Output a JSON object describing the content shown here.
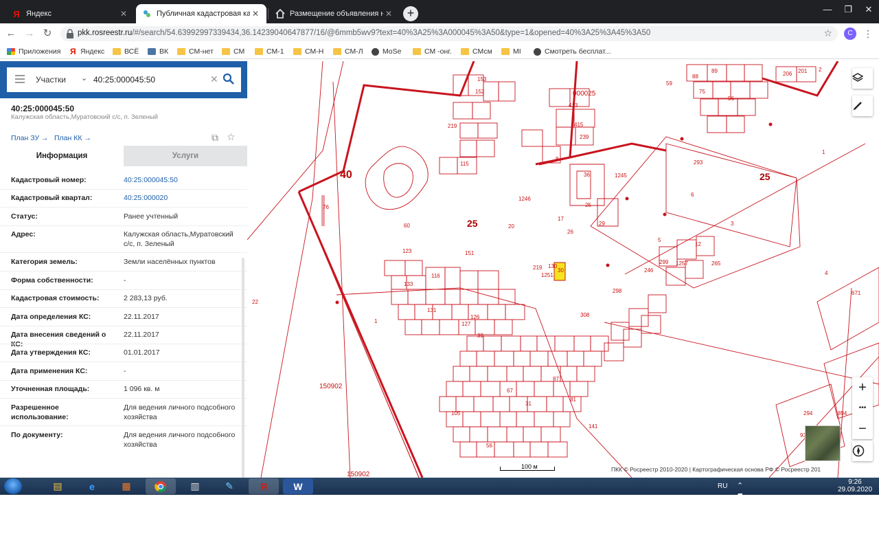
{
  "browser": {
    "tabs": [
      {
        "title": "Яндекс",
        "favicon": "Я",
        "active": false
      },
      {
        "title": "Публичная кадастровая карта",
        "favicon": "pkk",
        "active": true
      },
      {
        "title": "Размещение объявления на са",
        "favicon": "home",
        "active": false
      }
    ],
    "new_tab": "+",
    "url_host": "pkk.rosreestr.ru",
    "url_rest": "/#/search/54.63992997339434,36.14239040647877/16/@6mmb5wv9?text=40%3A25%3A000045%3A50&type=1&opened=40%3A25%3A45%3A50",
    "profile_initial": "С",
    "bookmarks": [
      "Приложения",
      "Яндекс",
      "ВСЁ",
      "ВК",
      "СМ-нет",
      "СМ",
      "СМ-1",
      "СМ-Н",
      "СМ-Л",
      "MoSe",
      "СМ -онг.",
      "СМсм",
      "MI",
      "Смотреть бесплат..."
    ]
  },
  "search": {
    "type_label": "Участки",
    "value": "40:25:000045:50"
  },
  "object": {
    "title": "40:25:000045:50",
    "address": "Калужская область,Муратовский с/с, п. Зеленый",
    "plan_zu": "План ЗУ →",
    "plan_kk": "План КК →"
  },
  "tabs": {
    "info": "Информация",
    "services": "Услуги"
  },
  "properties": [
    {
      "key": "Кадастровый номер:",
      "value": "40:25:000045:50",
      "link": true
    },
    {
      "key": "Кадастровый квартал:",
      "value": "40:25:000020",
      "link": true
    },
    {
      "key": "Статус:",
      "value": "Ранее учтенный",
      "link": false
    },
    {
      "key": "Адрес:",
      "value": "Калужская область,Муратовский с/с, п. Зеленый",
      "link": false
    },
    {
      "key": "Категория земель:",
      "value": "Земли населённых пунктов",
      "link": false
    },
    {
      "key": "Форма собственности:",
      "value": "-",
      "link": false
    },
    {
      "key": "Кадастровая стоимость:",
      "value": "2 283,13 руб.",
      "link": false
    },
    {
      "key": "Дата определения КС:",
      "value": "22.11.2017",
      "link": false
    },
    {
      "key": "Дата внесения сведений о КС:",
      "value": "22.11.2017",
      "link": false
    },
    {
      "key": "Дата утверждения КС:",
      "value": "01.01.2017",
      "link": false
    },
    {
      "key": "Дата применения КС:",
      "value": "-",
      "link": false
    },
    {
      "key": "Уточненная площадь:",
      "value": "1 096 кв. м",
      "link": false
    },
    {
      "key": "Разрешенное использование:",
      "value": "Для ведения личного подсобного хозяйства",
      "link": false
    },
    {
      "key": "По документу:",
      "value": "Для ведения личного подсобного хозяйства",
      "link": false
    }
  ],
  "map": {
    "big_labels": [
      "40",
      "25",
      "25"
    ],
    "district_label": "000025",
    "parcel_labels": [
      "150902",
      "150902",
      "1246",
      "1245",
      "1251",
      "1",
      "1",
      "3",
      "4",
      "22",
      "76",
      "17",
      "25",
      "29",
      "36",
      "26",
      "30",
      "219",
      "130",
      "131",
      "126",
      "127",
      "133",
      "123",
      "116",
      "39",
      "67",
      "87",
      "81",
      "31",
      "56",
      "105",
      "141",
      "298",
      "293",
      "308",
      "294",
      "938",
      "894",
      "671",
      "299",
      "265",
      "1257",
      "246",
      "5",
      "6",
      "8",
      "12",
      "20",
      "60",
      "151",
      "152",
      "153",
      "115",
      "219",
      "413",
      "415",
      "239",
      "89",
      "88",
      "75",
      "56",
      "59",
      "206",
      "201",
      "2"
    ],
    "scale_label": "100 м",
    "copyright": "ПКК © Росреестр 2010-2020 | Картографическая основа РФ © Росреестр 201",
    "zoom_in": "+",
    "zoom_more": "•••",
    "zoom_out": "−"
  },
  "taskbar": {
    "lang": "RU",
    "time": "9:26",
    "date": "29.09.2020"
  },
  "colors": {
    "accent": "#1e5fa8",
    "parcel_line": "#c8141e",
    "selected_parcel": "#f5e41e"
  }
}
